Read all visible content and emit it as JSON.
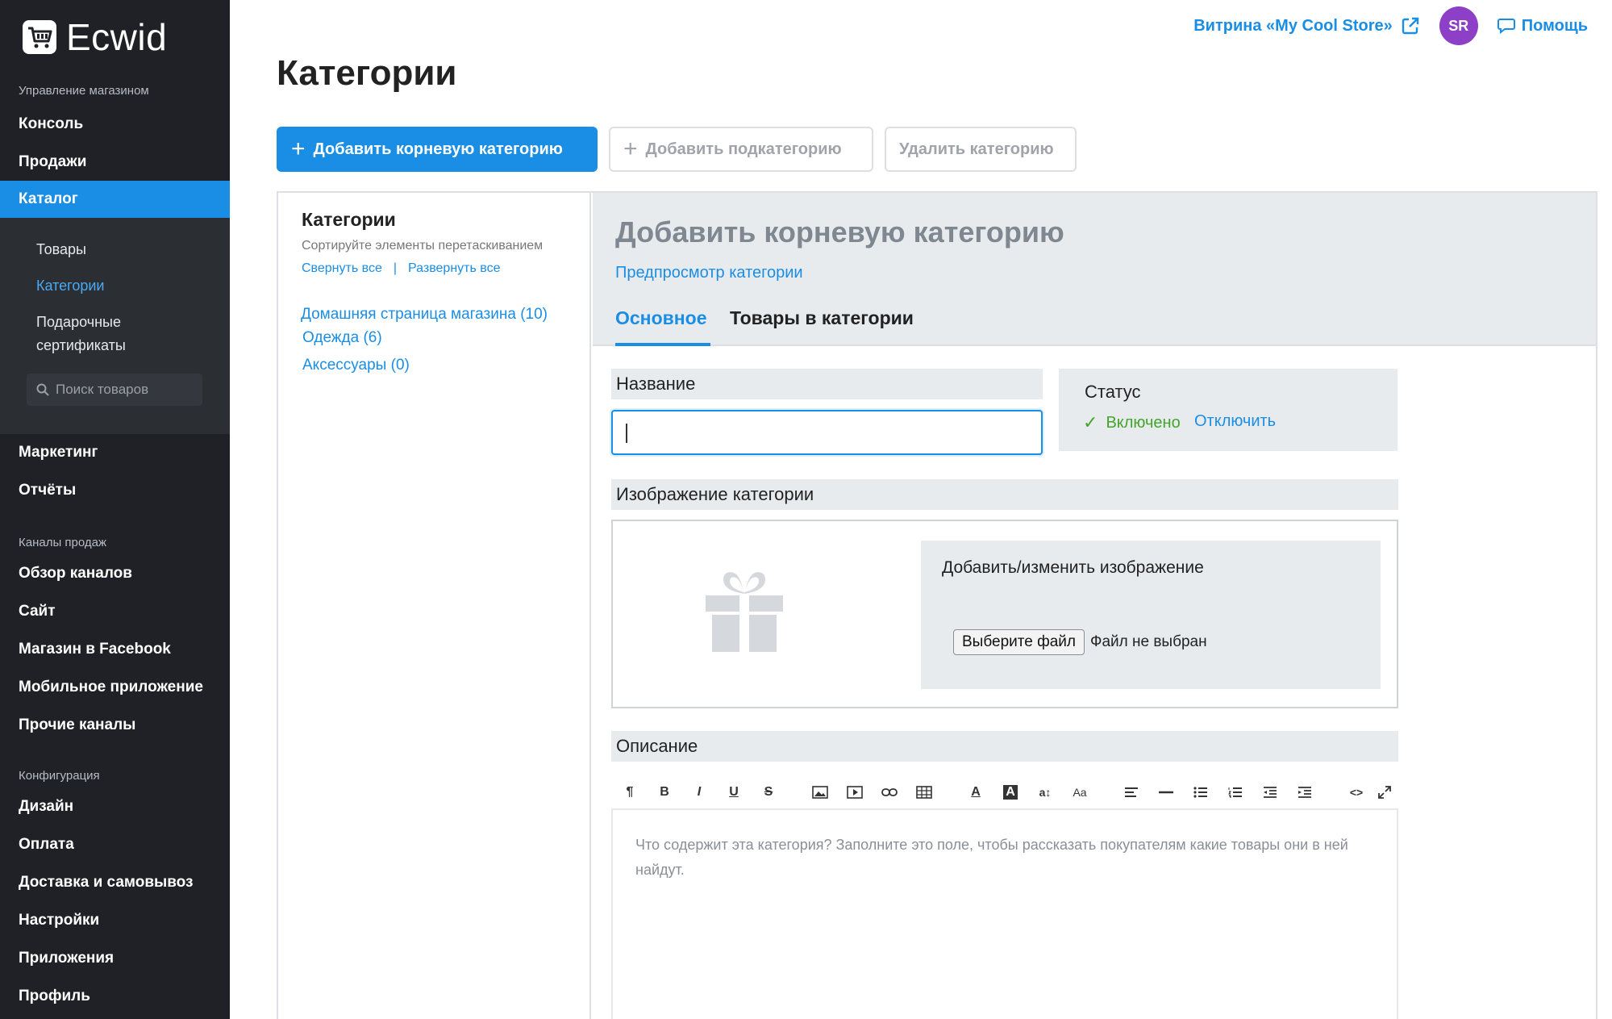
{
  "app": {
    "name": "Ecwid"
  },
  "sidebar": {
    "section_store": "Управление магазином",
    "items_top": [
      "Консоль",
      "Продажи"
    ],
    "active": "Каталог",
    "sub_items": [
      "Товары",
      "Категории",
      "Подарочные",
      "сертификаты"
    ],
    "search_placeholder": "Поиск товаров",
    "items_mid": [
      "Маркетинг",
      "Отчёты"
    ],
    "section_channels": "Каналы продаж",
    "channels": [
      "Обзор каналов",
      "Сайт",
      "Магазин в Facebook",
      "Мобильное приложение",
      "Прочие каналы"
    ],
    "section_config": "Конфигурация",
    "config": [
      "Дизайн",
      "Оплата",
      "Доставка и самовывоз",
      "Настройки",
      "Приложения",
      "Профиль"
    ]
  },
  "topbar": {
    "store_link": "Витрина «My Cool Store»",
    "avatar": "SR",
    "help": "Помощь"
  },
  "page_title": "Категории",
  "actions": {
    "add_root": "Добавить корневую категорию",
    "add_sub": "Добавить подкатегорию",
    "delete": "Удалить категорию"
  },
  "tree": {
    "title": "Категории",
    "hint": "Сортируйте элементы перетаскиванием",
    "collapse": "Свернуть все",
    "separator": "|",
    "expand": "Развернуть все",
    "items": [
      "Домашняя страница магазина (10)",
      "Одежда (6)",
      "Аксессуары (0)"
    ]
  },
  "editor": {
    "title": "Добавить корневую категорию",
    "preview": "Предпросмотр категории",
    "tabs": [
      "Основное",
      "Товары в категории"
    ],
    "name_label": "Название",
    "name_value": "",
    "status_label": "Статус",
    "status_on": "Включено",
    "status_off": "Отключить",
    "image_label": "Изображение категории",
    "image_change": "Добавить/изменить изображение",
    "file_button": "Выберите файл",
    "file_none": "Файл не выбран",
    "description_label": "Описание",
    "description_placeholder": "Что содержит эта категория? Заполните это поле, чтобы рассказать покупателям какие товары они в ней найдут."
  },
  "colors": {
    "accent": "#1a8ee5",
    "sidebar": "#1f2126",
    "success": "#43a52a",
    "avatar": "#8e3fc7"
  }
}
